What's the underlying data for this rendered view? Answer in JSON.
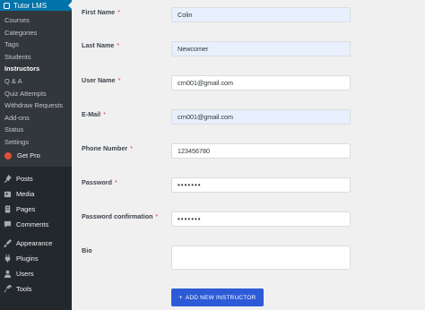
{
  "sidebar": {
    "plugin_title": "Tutor LMS",
    "sub_items": [
      {
        "label": "Courses"
      },
      {
        "label": "Categories"
      },
      {
        "label": "Tags"
      },
      {
        "label": "Students"
      },
      {
        "label": "Instructors",
        "current": true
      },
      {
        "label": "Q & A"
      },
      {
        "label": "Quiz Attempts"
      },
      {
        "label": "Withdraw Requests"
      },
      {
        "label": "Add-ons"
      },
      {
        "label": "Status"
      },
      {
        "label": "Settings"
      }
    ],
    "get_pro": "Get Pro",
    "main_items": [
      {
        "label": "Posts",
        "icon": "pin-icon"
      },
      {
        "label": "Media",
        "icon": "media-icon"
      },
      {
        "label": "Pages",
        "icon": "pages-icon"
      },
      {
        "label": "Comments",
        "icon": "comments-icon"
      },
      {
        "label": "Appearance",
        "icon": "appearance-icon"
      },
      {
        "label": "Plugins",
        "icon": "plugins-icon"
      },
      {
        "label": "Users",
        "icon": "users-icon"
      },
      {
        "label": "Tools",
        "icon": "tools-icon"
      }
    ]
  },
  "form": {
    "first_name": {
      "label": "First Name",
      "value": "Colin"
    },
    "last_name": {
      "label": "Last Name",
      "value": "Newcomer"
    },
    "user_name": {
      "label": "User Name",
      "value": "crn001@gmail.com"
    },
    "email": {
      "label": "E-Mail",
      "value": "crn001@gmail.com"
    },
    "phone": {
      "label": "Phone Number",
      "value": "123456780"
    },
    "password": {
      "label": "Password",
      "value": "•••••••"
    },
    "password_confirm": {
      "label": "Password confirmation",
      "value": "•••••••"
    },
    "bio": {
      "label": "Bio",
      "value": ""
    },
    "required_mark": "*",
    "submit_label": "ADD NEW INSTRUCTOR",
    "submit_icon": "+"
  },
  "colors": {
    "sidebar_bg": "#23282d",
    "active_bg": "#0073aa",
    "button_bg": "#2d5bd7",
    "autofill_bg": "#e8f0fe",
    "required": "#d63638"
  }
}
